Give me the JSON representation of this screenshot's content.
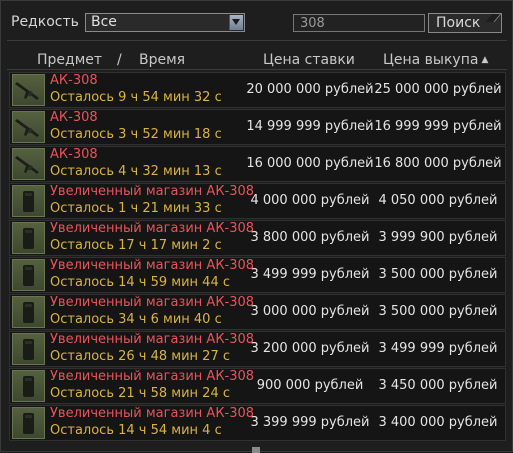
{
  "filter": {
    "rarity_label": "Редкость",
    "rarity_value": "Все",
    "search_value": "308",
    "search_button": "Поиск"
  },
  "header": {
    "item": "Предмет",
    "separator": "/",
    "time": "Время",
    "bid_price": "Цена ставки",
    "buyout_price": "Цена выкупа",
    "sort_indicator": "▲"
  },
  "rows": [
    {
      "icon": "rifle-icon",
      "name": "АК-308",
      "time": "Осталось 9 ч 54 мин 32 с",
      "bid": "20 000 000 рублей",
      "buyout": "25 000 000 рублей"
    },
    {
      "icon": "rifle-icon",
      "name": "АК-308",
      "time": "Осталось 3 ч 52 мин 18 с",
      "bid": "14 999 999 рублей",
      "buyout": "16 999 999 рублей"
    },
    {
      "icon": "rifle-icon",
      "name": "АК-308",
      "time": "Осталось 4 ч 32 мин 13 с",
      "bid": "16 000 000 рублей",
      "buyout": "16 800 000 рублей"
    },
    {
      "icon": "magazine-icon",
      "name": "Увеличенный магазин АК-308",
      "time": "Осталось 1 ч 21 мин 33 с",
      "bid": "4 000 000 рублей",
      "buyout": "4 050 000 рублей"
    },
    {
      "icon": "magazine-icon",
      "name": "Увеличенный магазин АК-308",
      "time": "Осталось 17 ч 17 мин 2 с",
      "bid": "3 800 000 рублей",
      "buyout": "3 999 900 рублей"
    },
    {
      "icon": "magazine-icon",
      "name": "Увеличенный магазин АК-308",
      "time": "Осталось 14 ч 59 мин 44 с",
      "bid": "3 499 999 рублей",
      "buyout": "3 500 000 рублей"
    },
    {
      "icon": "magazine-icon",
      "name": "Увеличенный магазин АК-308",
      "time": "Осталось 34 ч 6 мин 40 с",
      "bid": "3 000 000 рублей",
      "buyout": "3 500 000 рублей"
    },
    {
      "icon": "magazine-icon",
      "name": "Увеличенный магазин АК-308",
      "time": "Осталось 26 ч 48 мин 27 с",
      "bid": "3 200 000 рублей",
      "buyout": "3 499 999 рублей"
    },
    {
      "icon": "magazine-icon",
      "name": "Увеличенный магазин АК-308",
      "time": "Осталось 21 ч 58 мин 24 с",
      "bid": "900 000 рублей",
      "buyout": "3 450 000 рублей"
    },
    {
      "icon": "magazine-icon",
      "name": "Увеличенный магазин АК-308",
      "time": "Осталось 14 ч 54 мин 4 с",
      "bid": "3 399 999 рублей",
      "buyout": "3 400 000 рублей"
    }
  ],
  "colors": {
    "item_name": "#e8545a",
    "time_left": "#d9b440",
    "price": "#e4e4e4",
    "background": "#1e1e1e"
  }
}
